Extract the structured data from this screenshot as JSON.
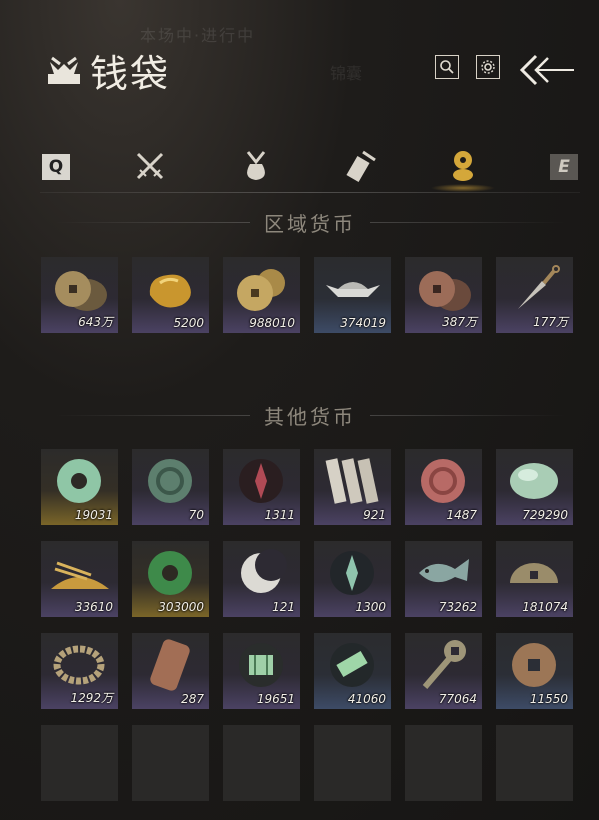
{
  "window": {
    "title": "钱袋",
    "bg_text_1": "本场中·进行中",
    "bg_text_2": "锦囊"
  },
  "tabs": {
    "prev_key": "Q",
    "next_key": "E",
    "items": [
      {
        "icon": "crossed-swords-icon"
      },
      {
        "icon": "pouch-icon"
      },
      {
        "icon": "scroll-icon"
      },
      {
        "icon": "coin-stack-icon",
        "active": true
      }
    ],
    "accent_color": "#d4a73a"
  },
  "regional": {
    "label": "区域货币",
    "items": [
      {
        "icon": "copper-coins-icon",
        "qty": "643万",
        "rarity": "purple"
      },
      {
        "icon": "gold-nugget-icon",
        "qty": "5200",
        "rarity": "purple"
      },
      {
        "icon": "gold-coins-icon",
        "qty": "988010",
        "rarity": "purple"
      },
      {
        "icon": "silver-ingot-icon",
        "qty": "374019",
        "rarity": "blue"
      },
      {
        "icon": "bronze-coins-icon",
        "qty": "387万",
        "rarity": "purple"
      },
      {
        "icon": "throwing-knife-icon",
        "qty": "177万",
        "rarity": "purple"
      }
    ]
  },
  "other": {
    "label": "其他货币",
    "items": [
      {
        "icon": "jade-ring-icon",
        "qty": "19031",
        "rarity": "gold"
      },
      {
        "icon": "jade-stone-icon",
        "qty": "70",
        "rarity": "purple"
      },
      {
        "icon": "red-emblem-icon",
        "qty": "1311",
        "rarity": "purple"
      },
      {
        "icon": "bamboo-slips-icon",
        "qty": "921",
        "rarity": "purple"
      },
      {
        "icon": "red-stone-icon",
        "qty": "1487",
        "rarity": "purple"
      },
      {
        "icon": "jade-pebble-icon",
        "qty": "729290",
        "rarity": "purple"
      },
      {
        "icon": "grain-pile-icon",
        "qty": "33610",
        "rarity": "purple"
      },
      {
        "icon": "green-jade-ring-icon",
        "qty": "303000",
        "rarity": "gold"
      },
      {
        "icon": "crescent-moon-icon",
        "qty": "121",
        "rarity": "purple"
      },
      {
        "icon": "green-emblem-icon",
        "qty": "1300",
        "rarity": "purple"
      },
      {
        "icon": "fish-icon",
        "qty": "73262",
        "rarity": "purple"
      },
      {
        "icon": "broken-coin-icon",
        "qty": "181074",
        "rarity": "purple"
      },
      {
        "icon": "bead-bracelet-icon",
        "qty": "1292万",
        "rarity": "purple"
      },
      {
        "icon": "copper-plate-icon",
        "qty": "287",
        "rarity": "purple"
      },
      {
        "icon": "map-token-icon",
        "qty": "19651",
        "rarity": "purple"
      },
      {
        "icon": "green-ticket-icon",
        "qty": "41060",
        "rarity": "blue"
      },
      {
        "icon": "key-coin-icon",
        "qty": "77064",
        "rarity": "purple"
      },
      {
        "icon": "square-hole-coin-icon",
        "qty": "11550",
        "rarity": "blue"
      }
    ]
  }
}
